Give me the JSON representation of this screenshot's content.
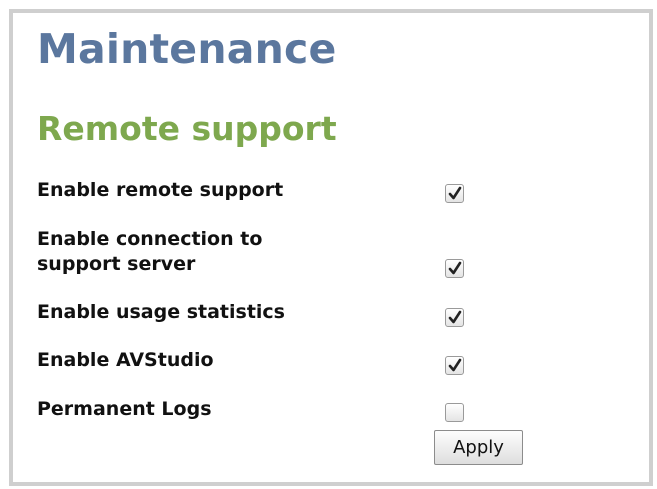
{
  "page": {
    "title": "Maintenance"
  },
  "remote_support": {
    "heading": "Remote support",
    "settings": [
      {
        "label": "Enable remote support",
        "checked": true
      },
      {
        "label_line1": "Enable connection to",
        "label_line2": "support server",
        "checked": true
      },
      {
        "label": "Enable usage statistics",
        "checked": true
      },
      {
        "label": "Enable AVStudio",
        "checked": true
      },
      {
        "label": "Permanent Logs",
        "checked": false
      }
    ],
    "apply_label": "Apply"
  },
  "colors": {
    "title": "#5b779e",
    "section_heading": "#7ea84e",
    "frame_border": "#cfcfcf"
  }
}
